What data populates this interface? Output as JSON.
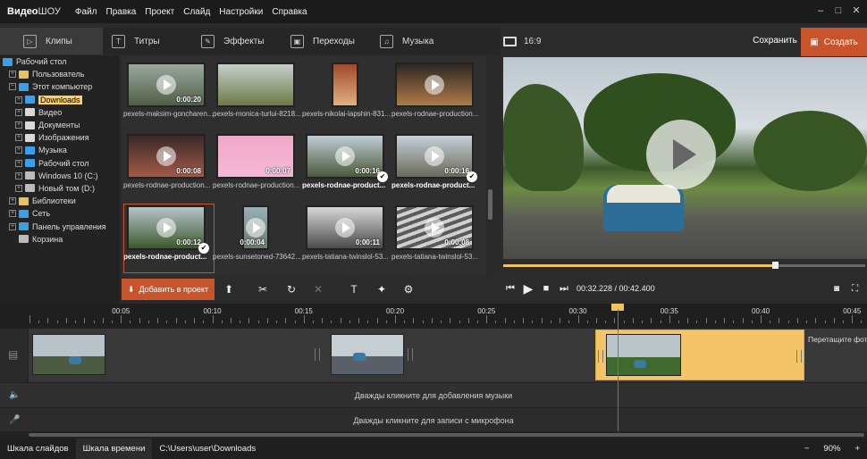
{
  "app": {
    "logo_part1": "Видео",
    "logo_part2": "ШОУ"
  },
  "menu": [
    "Файл",
    "Правка",
    "Проект",
    "Слайд",
    "Настройки",
    "Справка"
  ],
  "window_controls": [
    "–",
    "□",
    "✕"
  ],
  "tabs": [
    {
      "label": "Клипы",
      "active": true
    },
    {
      "label": "Титры"
    },
    {
      "label": "Эффекты"
    },
    {
      "label": "Переходы"
    },
    {
      "label": "Музыка"
    }
  ],
  "ratio_label": "16:9",
  "save_label": "Сохранить",
  "create_label": "Создать",
  "tree": [
    {
      "label": "Рабочий стол",
      "level": 0,
      "expander": "",
      "color": "#3aa0e8"
    },
    {
      "label": "Пользователь",
      "level": 1,
      "expander": "+",
      "color": "#e8c25a"
    },
    {
      "label": "Этот компьютер",
      "level": 1,
      "expander": "−",
      "color": "#3aa0e8"
    },
    {
      "label": "Downloads",
      "level": 2,
      "expander": "+",
      "color": "#3aa0e8",
      "highlight": true
    },
    {
      "label": "Видео",
      "level": 2,
      "expander": "+",
      "color": "#d9d9d9"
    },
    {
      "label": "Документы",
      "level": 2,
      "expander": "+",
      "color": "#d9d9d9"
    },
    {
      "label": "Изображения",
      "level": 2,
      "expander": "+",
      "color": "#d9d9d9"
    },
    {
      "label": "Музыка",
      "level": 2,
      "expander": "+",
      "color": "#3aa0e8"
    },
    {
      "label": "Рабочий стол",
      "level": 2,
      "expander": "+",
      "color": "#3aa0e8"
    },
    {
      "label": "Windows 10 (C:)",
      "level": 2,
      "expander": "+",
      "color": "#bbbbbb"
    },
    {
      "label": "Новый том (D:)",
      "level": 2,
      "expander": "+",
      "color": "#bbbbbb"
    },
    {
      "label": "Библиотеки",
      "level": 1,
      "expander": "+",
      "color": "#e8c25a"
    },
    {
      "label": "Сеть",
      "level": 1,
      "expander": "+",
      "color": "#3aa0e8"
    },
    {
      "label": "Панель управления",
      "level": 1,
      "expander": "+",
      "color": "#3aa0e8"
    },
    {
      "label": "Корзина",
      "level": 1,
      "expander": "",
      "color": "#bbbbbb"
    }
  ],
  "thumbnails": [
    {
      "name": "pexels-maksim-goncharen...",
      "duration": "0:00:20",
      "bg": "linear-gradient(#9aa8a0,#4f5e43)",
      "play": true
    },
    {
      "name": "pexels-monica-turlui-8218...",
      "duration": "",
      "bg": "linear-gradient(#c7cfc9,#6d7a48)",
      "play": false
    },
    {
      "name": "pexels-nikolai-lapshin-831...",
      "duration": "",
      "bg": "linear-gradient(#a04a2c,#e0b080)",
      "play": false,
      "narrow": true
    },
    {
      "name": "pexels-rodnae-production...",
      "duration": "",
      "bg": "linear-gradient(#2e2822,#b07a48)",
      "play": true
    },
    {
      "name": "pexels-rodnae-production...",
      "duration": "0:00:08",
      "bg": "linear-gradient(#3a2a28,#a35a48)",
      "play": true
    },
    {
      "name": "pexels-rodnae-production...",
      "duration": "0:00:07",
      "bg": "linear-gradient(#f0a8c8,#f4b8d4)",
      "play": false
    },
    {
      "name": "pexels-rodnae-product...",
      "duration": "0:00:16",
      "bg": "linear-gradient(#c0ccd4,#4a5a3a)",
      "play": true,
      "check": true,
      "bold": true
    },
    {
      "name": "pexels-rodnae-product...",
      "duration": "0:00:16",
      "bg": "linear-gradient(#c5d0d6,#6a6a5a)",
      "play": true,
      "check": true,
      "bold": true
    },
    {
      "name": "pexels-rodnae-product...",
      "duration": "0:00:12",
      "bg": "linear-gradient(#b8c4cc,#3b5a2a)",
      "play": true,
      "check": true,
      "bold": true,
      "selected": true
    },
    {
      "name": "pexels-sunsetoned-73642...",
      "duration": "0:00:04",
      "bg": "linear-gradient(#9ab0b8,#6a7a6a)",
      "play": true,
      "narrow": true
    },
    {
      "name": "pexels-tatiana-twinslol-53...",
      "duration": "0:00:11",
      "bg": "linear-gradient(#d8d8d8,#4a4a4a)",
      "play": true
    },
    {
      "name": "pexels-tatiana-twinslol-53...",
      "duration": "0:00:08",
      "bg": "repeating-linear-gradient(160deg,#d0d0d0 0 4px,#5a5a5a 4px 8px)",
      "play": true
    }
  ],
  "add_to_project_label": "Добавить в проект",
  "playback": {
    "time": "00:32.228 / 00:42.400",
    "progress_fraction": 0.75
  },
  "ruler_labels": [
    "00:05",
    "00:10",
    "00:15",
    "00:20",
    "00:25",
    "00:30",
    "00:35",
    "00:40",
    "00:45"
  ],
  "timeline_hint": "Перетащите фото или видео из списка выше",
  "music_hint": "Дважды кликните для добавления музыки",
  "mic_hint": "Дважды кликните для записи с микрофона",
  "status": {
    "slides_tab": "Шкала слайдов",
    "timeline_tab": "Шкала времени",
    "path": "C:\\Users\\user\\Downloads",
    "zoom": "90%",
    "minus": "−",
    "plus": "+"
  }
}
